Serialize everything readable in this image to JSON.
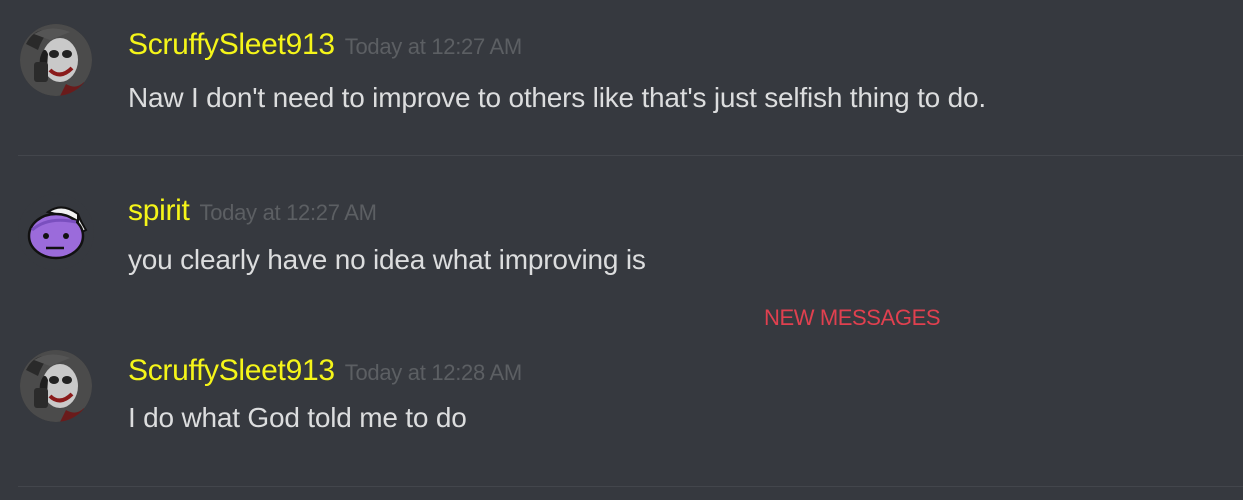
{
  "messages": [
    {
      "author": "ScruffySleet913",
      "timestamp": "Today at 12:27 AM",
      "text": "Naw I don't need to improve to others like that's just selfish thing to do.",
      "avatar": "joker-avatar-icon"
    },
    {
      "author": "spirit",
      "timestamp": "Today at 12:27 AM",
      "text": "you clearly have no idea what improving is",
      "avatar": "purple-face-avatar-icon"
    },
    {
      "author": "ScruffySleet913",
      "timestamp": "Today at 12:28 AM",
      "text": "I do what God told me to do",
      "avatar": "joker-avatar-icon"
    }
  ],
  "new_messages_label": "NEW MESSAGES",
  "colors": {
    "background": "#36393f",
    "username": "#f5f519",
    "timestamp": "#5c5f63",
    "message_text": "#dcddde",
    "new_messages": "#e0404f",
    "divider": "#43464c"
  }
}
